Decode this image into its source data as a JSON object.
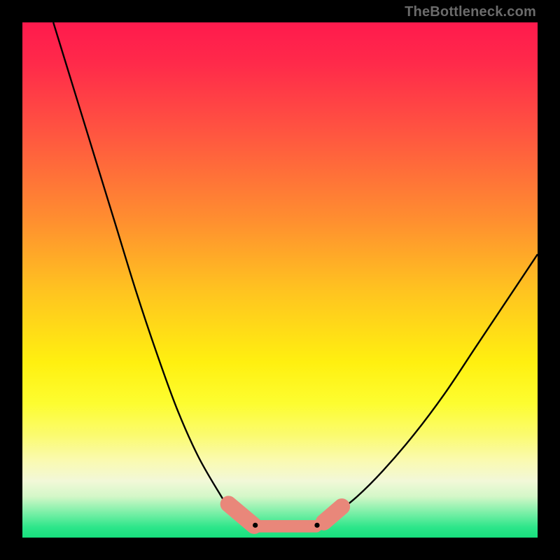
{
  "watermark": "TheBottleneck.com",
  "colors": {
    "background": "#000000",
    "curve": "#000000",
    "marker_fill": "#e9877a",
    "marker_stroke": "#d86f62"
  },
  "chart_data": {
    "type": "line",
    "title": "",
    "xlabel": "",
    "ylabel": "",
    "xlim": [
      0,
      100
    ],
    "ylim": [
      0,
      100
    ],
    "series": [
      {
        "name": "left-curve",
        "x": [
          6,
          10,
          14,
          18,
          22,
          26,
          30,
          34,
          38,
          41,
          44,
          46
        ],
        "y": [
          100,
          87,
          74,
          61,
          48,
          36,
          25,
          16,
          9,
          4.5,
          2.5,
          2
        ]
      },
      {
        "name": "plateau",
        "x": [
          46,
          50,
          54,
          57
        ],
        "y": [
          2,
          1.8,
          1.8,
          2
        ]
      },
      {
        "name": "right-curve",
        "x": [
          57,
          60,
          65,
          70,
          76,
          82,
          88,
          94,
          100
        ],
        "y": [
          2,
          4,
          8,
          13,
          20,
          28,
          37,
          46,
          55
        ]
      }
    ],
    "markers": [
      {
        "name": "left-marker",
        "x0": 40.0,
        "y0": 6.5,
        "x1": 45.0,
        "y1": 2.3,
        "width": 3.2
      },
      {
        "name": "bottom-marker",
        "x0": 45.0,
        "y0": 2.2,
        "x1": 57.0,
        "y1": 2.2,
        "width": 2.4
      },
      {
        "name": "right-marker",
        "x0": 58.5,
        "y0": 3.0,
        "x1": 62.0,
        "y1": 6.0,
        "width": 3.2
      }
    ],
    "dots": [
      {
        "name": "dot-left",
        "x": 45.2,
        "y": 2.4
      },
      {
        "name": "dot-right",
        "x": 57.2,
        "y": 2.4
      }
    ]
  }
}
